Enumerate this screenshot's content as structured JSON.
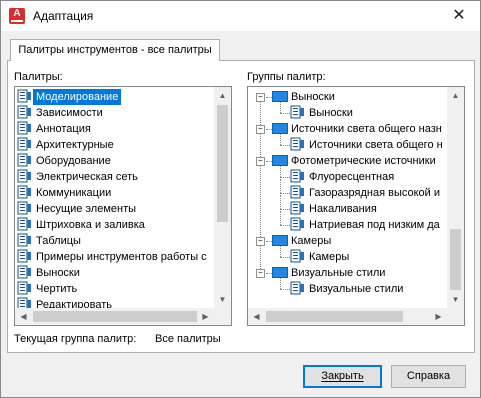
{
  "window": {
    "title": "Адаптация",
    "close_glyph": "✕"
  },
  "tab": {
    "label": "Палитры инструментов - все палитры"
  },
  "palettes": {
    "label": "Палитры:",
    "items": [
      {
        "label": "Моделирование",
        "selected": true
      },
      {
        "label": "Зависимости"
      },
      {
        "label": "Аннотация"
      },
      {
        "label": "Архитектурные"
      },
      {
        "label": "Оборудование"
      },
      {
        "label": "Электрическая сеть"
      },
      {
        "label": "Коммуникации"
      },
      {
        "label": "Несущие элементы"
      },
      {
        "label": "Штриховка и заливка"
      },
      {
        "label": "Таблицы"
      },
      {
        "label": "Примеры инструментов работы с"
      },
      {
        "label": "Выноски"
      },
      {
        "label": "Чертить"
      },
      {
        "label": "Редактировать"
      }
    ]
  },
  "groups": {
    "label": "Группы палитр:",
    "tree": [
      {
        "label": "Выноски",
        "level": 0
      },
      {
        "label": "Выноски",
        "level": 1
      },
      {
        "label": "Источники света общего назн",
        "level": 0
      },
      {
        "label": "Источники света общего н",
        "level": 1
      },
      {
        "label": "Фотометрические источники",
        "level": 0
      },
      {
        "label": "Флуоресцентная",
        "level": 1
      },
      {
        "label": "Газоразрядная высокой и",
        "level": 1
      },
      {
        "label": "Накаливания",
        "level": 1
      },
      {
        "label": "Натриевая под низким да",
        "level": 1
      },
      {
        "label": "Камеры",
        "level": 0
      },
      {
        "label": "Камеры",
        "level": 1
      },
      {
        "label": "Визуальные стили",
        "level": 0
      },
      {
        "label": "Визуальные стили",
        "level": 1
      }
    ]
  },
  "current_group": {
    "label": "Текущая группа палитр:",
    "value": "Все палитры"
  },
  "buttons": {
    "close": "Закрыть",
    "help": "Справка"
  },
  "colors": {
    "accent": "#0078d7",
    "folder": "#1e88e5",
    "app_icon": "#d32f2f"
  }
}
